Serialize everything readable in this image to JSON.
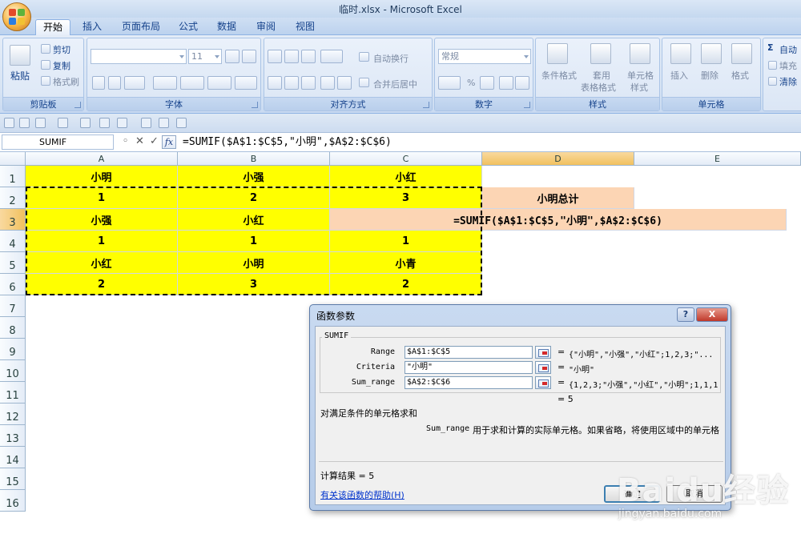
{
  "window": {
    "title": "临时.xlsx - Microsoft Excel"
  },
  "tabs": [
    "开始",
    "插入",
    "页面布局",
    "公式",
    "数据",
    "审阅",
    "视图"
  ],
  "active_tab": "开始",
  "ribbon": {
    "clipboard": {
      "label": "剪贴板",
      "paste": "粘贴",
      "cut": "剪切",
      "copy": "复制",
      "format_painter": "格式刷"
    },
    "font": {
      "label": "字体",
      "size": "11"
    },
    "alignment": {
      "label": "对齐方式",
      "wrap": "自动换行",
      "merge": "合并后居中"
    },
    "number": {
      "label": "数字",
      "format": "常规",
      "percent": "%"
    },
    "styles": {
      "label": "样式",
      "conditional": "条件格式",
      "table_line1": "套用",
      "table_line2": "表格格式",
      "cell_styles_line1": "单元格",
      "cell_styles_line2": "样式"
    },
    "cells": {
      "label": "单元格",
      "insert": "插入",
      "delete": "删除",
      "format": "格式"
    },
    "editing": {
      "autosum": "自动",
      "fill": "填充",
      "clear": "清除"
    }
  },
  "formula_bar": {
    "name_box": "SUMIF",
    "formula": "=SUMIF($A$1:$C$5,\"小明\",$A$2:$C$6)"
  },
  "columns": [
    "A",
    "B",
    "C",
    "D",
    "E"
  ],
  "rows": [
    "1",
    "2",
    "3",
    "4",
    "5",
    "6",
    "7",
    "8",
    "9",
    "10",
    "11",
    "12",
    "13",
    "14",
    "15",
    "16"
  ],
  "cells": {
    "A1": "小明",
    "B1": "小强",
    "C1": "小红",
    "A2": "1",
    "B2": "2",
    "C2": "3",
    "D2": "小明总计",
    "A3": "小强",
    "B3": "小红",
    "C3": "=SUMIF($A$1:$C$5,\"小明\",$A$2:$C$6)",
    "A4": "1",
    "B4": "1",
    "C4": "1",
    "A5": "小红",
    "B5": "小明",
    "C5": "小青",
    "A6": "2",
    "B6": "3",
    "C6": "2"
  },
  "colors": {
    "highlight_yellow": "#ffff00",
    "highlight_peach": "#fcd5b4",
    "selection_orange": "#f1c15f"
  },
  "dialog": {
    "title": "函数参数",
    "function_name": "SUMIF",
    "args": [
      {
        "label": "Range",
        "value": "$A$1:$C$5",
        "result": "{\"小明\",\"小强\",\"小红\";1,2,3;\"..."
      },
      {
        "label": "Criteria",
        "value": "\"小明\"",
        "result": "\"小明\""
      },
      {
        "label": "Sum_range",
        "value": "$A$2:$C$6",
        "result": "{1,2,3;\"小强\",\"小红\",\"小明\";1,1,1"
      }
    ],
    "eq": "=",
    "total": "= 5",
    "description": "对满足条件的单元格求和",
    "arg_help_name": "Sum_range",
    "arg_help_text": "用于求和计算的实际单元格。如果省略，将使用区域中的单元格",
    "calc_result": "计算结果 = 5",
    "help_link": "有关该函数的帮助(H)",
    "ok": "确定",
    "cancel": "取消",
    "help_btn": "?",
    "close_btn": "X"
  },
  "watermark": {
    "text": "Baidu经验",
    "url": "jingyan.baidu.com"
  }
}
